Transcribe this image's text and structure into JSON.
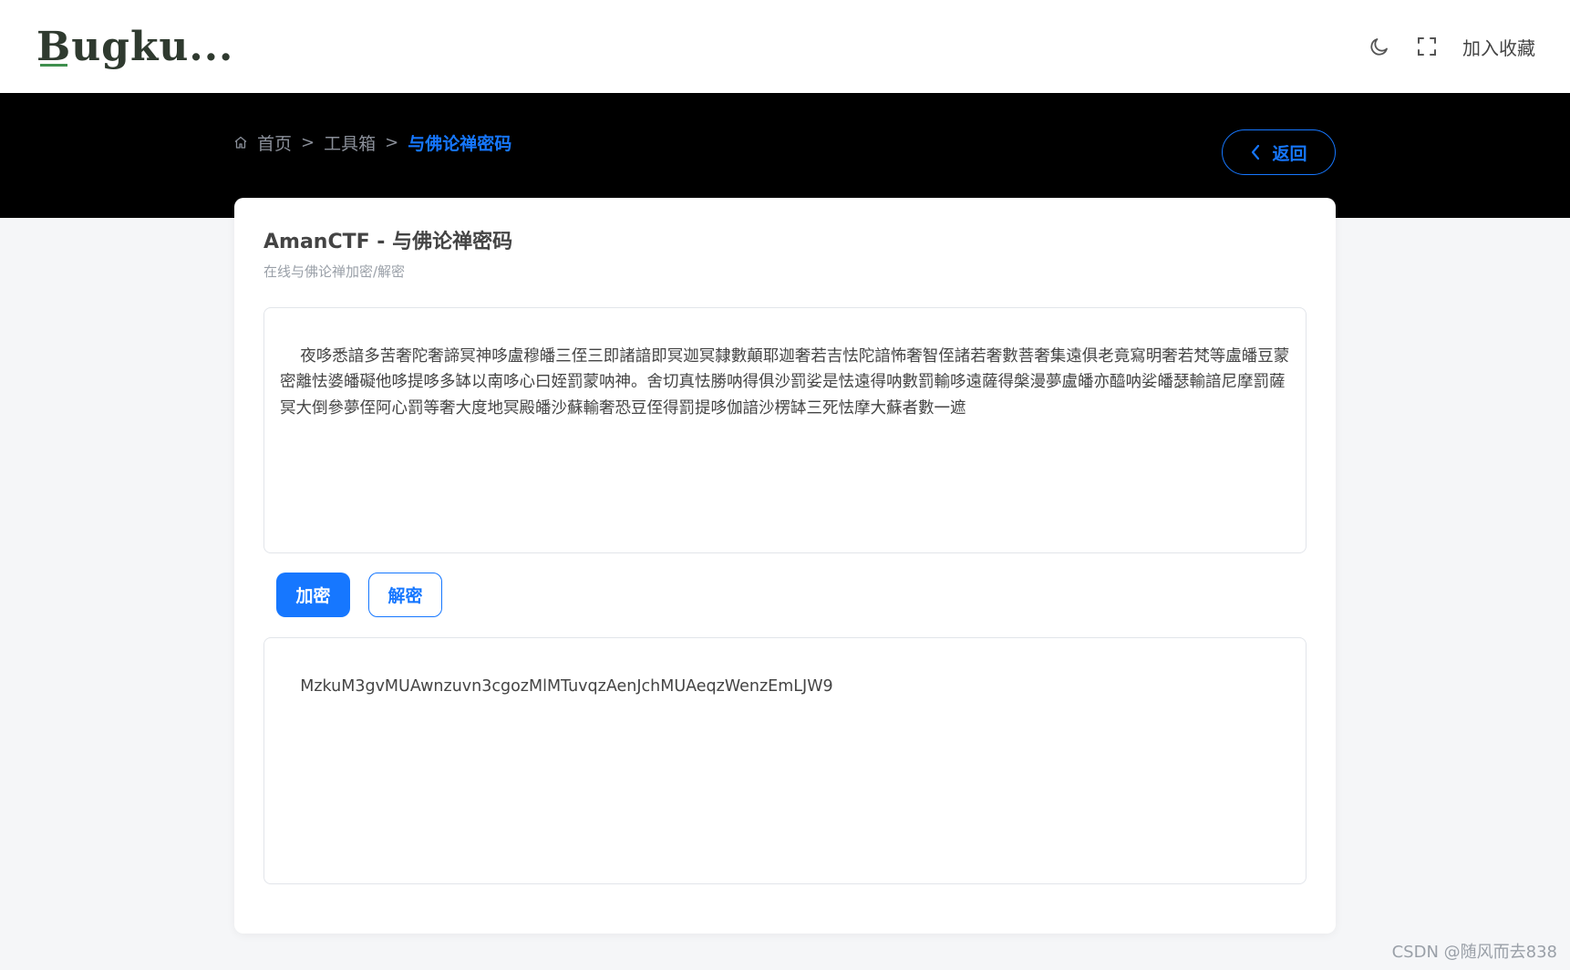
{
  "header": {
    "logo_text": "Bugku...",
    "theme_toggle_icon": "moon-icon",
    "fullscreen_icon": "fullscreen-icon",
    "favorite_label": "加入收藏"
  },
  "breadcrumb": {
    "home_icon": "home-icon",
    "items": [
      "首页",
      "工具箱",
      "与佛论禅密码"
    ],
    "separator": ">"
  },
  "back_button": {
    "label": "返回",
    "icon": "chevron-left-icon"
  },
  "tool": {
    "title": "AmanCTF - 与佛论禅密码",
    "subtitle": "在线与佛论禅加密/解密",
    "input_text": "夜哆悉諳多苦奢陀奢諦冥神哆盧穆皤三侄三即諸諳即冥迦冥隸數顛耶迦奢若吉怯陀諳怖奢智侄諸若奢數菩奢集遠俱老竟寫明奢若梵等盧皤豆蒙密離怯婆皤礙他哆提哆多缽以南哆心曰姪罰蒙呐神。舍切真怯勝呐得俱沙罰娑是怯遠得呐數罰輸哆遠薩得槃漫夢盧皤亦醯呐娑皤瑟輸諳尼摩罰薩冥大倒參夢侄阿心罰等奢大度地冥殿皤沙蘇輸奢恐豆侄得罰提哆伽諳沙楞缽三死怯摩大蘇者數一遮",
    "encrypt_label": "加密",
    "decrypt_label": "解密",
    "output_text": "MzkuM3gvMUAwnzuvn3cgozMlMTuvqzAenJchMUAeqzWenzEmLJW9"
  },
  "watermark": "CSDN @随风而去838",
  "colors": {
    "accent": "#1677ff",
    "banner": "#000000",
    "page_bg": "#f5f6f8"
  }
}
